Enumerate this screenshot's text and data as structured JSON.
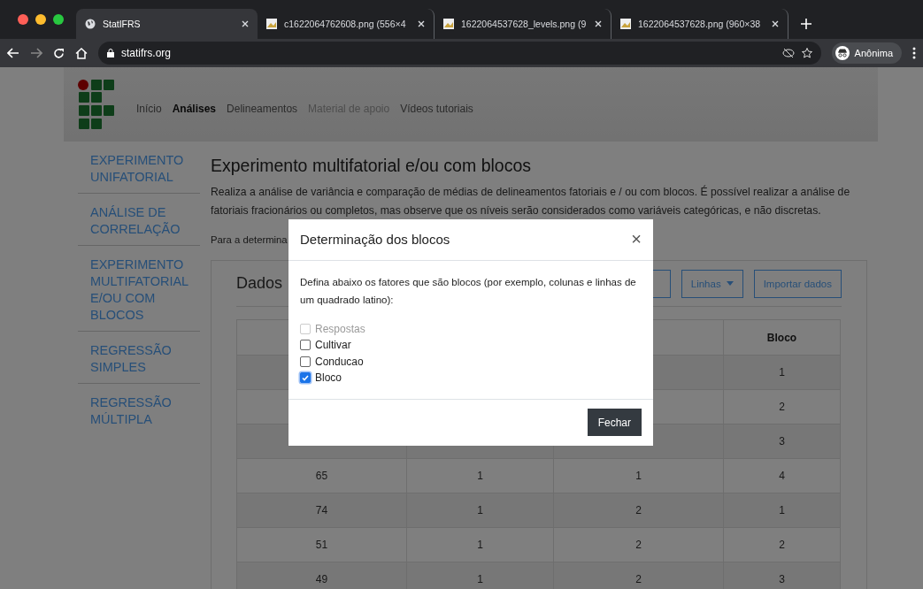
{
  "browser": {
    "tabs": [
      {
        "title": "StatIFRS",
        "selected": true,
        "kind": "site"
      },
      {
        "title": "c1622064762608.png (556×4",
        "selected": false,
        "kind": "image"
      },
      {
        "title": "1622064537628_levels.png (9",
        "selected": false,
        "kind": "image"
      },
      {
        "title": "1622064537628.png (960×38",
        "selected": false,
        "kind": "image"
      }
    ],
    "address": "statifrs.org",
    "profile": "Anônima"
  },
  "nav": [
    {
      "label": "Início",
      "selected": false,
      "disabled": false
    },
    {
      "label": "Análises",
      "selected": true,
      "disabled": false
    },
    {
      "label": "Delineamentos",
      "selected": false,
      "disabled": false
    },
    {
      "label": "Material de apoio",
      "selected": false,
      "disabled": true
    },
    {
      "label": "Vídeos tutoriais",
      "selected": false,
      "disabled": false
    }
  ],
  "sidebar": {
    "items": [
      {
        "label": "EXPERIMENTO UNIFATORIAL"
      },
      {
        "label": "ANÁLISE DE CORRELAÇÃO"
      },
      {
        "label": "EXPERIMENTO MULTIFATORIAL E/OU COM BLOCOS"
      },
      {
        "label": "REGRESSÃO SIMPLES"
      },
      {
        "label": "REGRESSÃO MÚLTIPLA"
      }
    ]
  },
  "main": {
    "title": "Experimento multifatorial e/ou com blocos",
    "description": "Realiza a análise de variância e comparação de médias de delineamentos fatoriais e / ou com blocos. É possível realizar a análise de fatoriais fracionários ou completos, mas observe que os níveis serão considerados como variáveis categóricas, e não discretas.",
    "note": "Para a determina"
  },
  "card": {
    "title": "Dados",
    "buttons": [
      {
        "label": "Linhas",
        "kind": "dropdown"
      },
      {
        "label": "Importar dados",
        "kind": "plain"
      }
    ],
    "table": {
      "bloco_heading": "Bloco",
      "rows": [
        {
          "bloco": "1"
        },
        {
          "bloco": "2"
        },
        {
          "bloco": "3"
        },
        {
          "column_1": "65",
          "column_2": "1",
          "column_3": "1",
          "bloco": "4"
        },
        {
          "column_1": "74",
          "column_2": "1",
          "column_3": "2",
          "bloco": "1"
        },
        {
          "column_1": "51",
          "column_2": "1",
          "column_3": "2",
          "bloco": "2"
        },
        {
          "column_1": "49",
          "column_2": "1",
          "column_3": "2",
          "bloco": "3"
        }
      ]
    }
  },
  "modal": {
    "title": "Determinação dos blocos",
    "close": "×",
    "text": "Defina abaixo os fatores que são blocos (por exemplo, colunas e linhas de um quadrado latino):",
    "options": [
      {
        "label": "Respostas",
        "checked": false,
        "disabled": true
      },
      {
        "label": "Cultivar",
        "checked": false,
        "disabled": false
      },
      {
        "label": "Conducao",
        "checked": false,
        "disabled": false
      },
      {
        "label": "Bloco",
        "checked": true,
        "disabled": false
      }
    ],
    "button": "Fechar"
  }
}
